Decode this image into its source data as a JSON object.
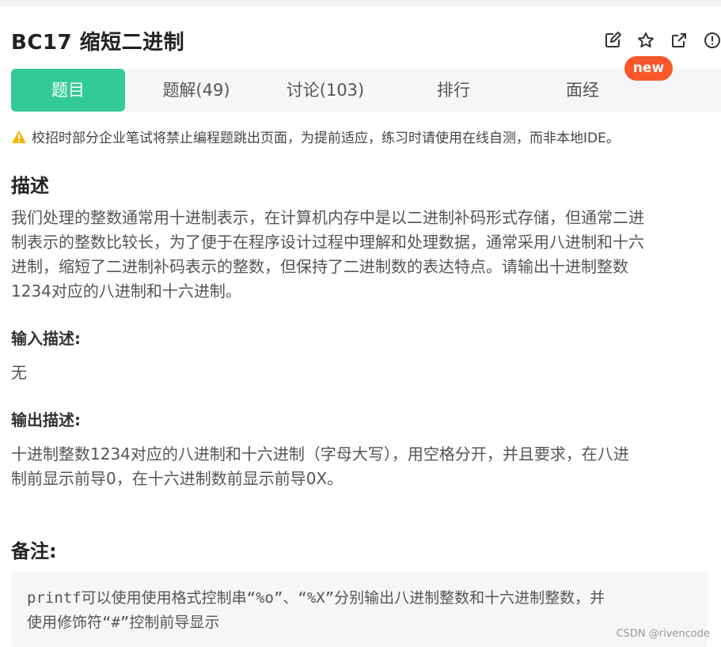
{
  "problem": {
    "title": "BC17  缩短二进制"
  },
  "tabs": [
    {
      "label": "题目"
    },
    {
      "label": "题解(49)"
    },
    {
      "label": "讨论(103)"
    },
    {
      "label": "排行"
    },
    {
      "label": "面经"
    }
  ],
  "badge": {
    "label": "new"
  },
  "warning": {
    "text": "校招时部分企业笔试将禁止编程题跳出页面，为提前适应，练习时请使用在线自测，而非本地IDE。"
  },
  "description": {
    "heading": "描述",
    "lines": [
      "我们处理的整数通常用十进制表示，在计算机内存中是以二进制补码形式存储，但通常二进",
      "制表示的整数比较长，为了便于在程序设计过程中理解和处理数据，通常采用八进制和十六",
      "进制，缩短了二进制补码表示的整数，但保持了二进制数的表达特点。请输出十进制整数",
      "1234对应的八进制和十六进制。"
    ]
  },
  "input": {
    "heading": "输入描述:",
    "text": "无"
  },
  "output": {
    "heading": "输出描述:",
    "lines": [
      "十进制整数1234对应的八进制和十六进制（字母大写），用空格分开，并且要求，在八进",
      "制前显示前导0，在十六进制数前显示前导0X。"
    ]
  },
  "note": {
    "heading": "备注:",
    "lines": [
      "printf可以使用使用格式控制串“%o”、“%X”分别输出八进制整数和十六进制整数，并",
      "使用修饰符“#”控制前导显示"
    ]
  },
  "watermark": "CSDN @rivencode",
  "colors": {
    "accent": "#32ca99",
    "badge": "#f7572a",
    "warning": "#f5b800"
  },
  "icons": [
    "edit-icon",
    "star-icon",
    "share-icon",
    "report-icon",
    "warning-icon"
  ]
}
